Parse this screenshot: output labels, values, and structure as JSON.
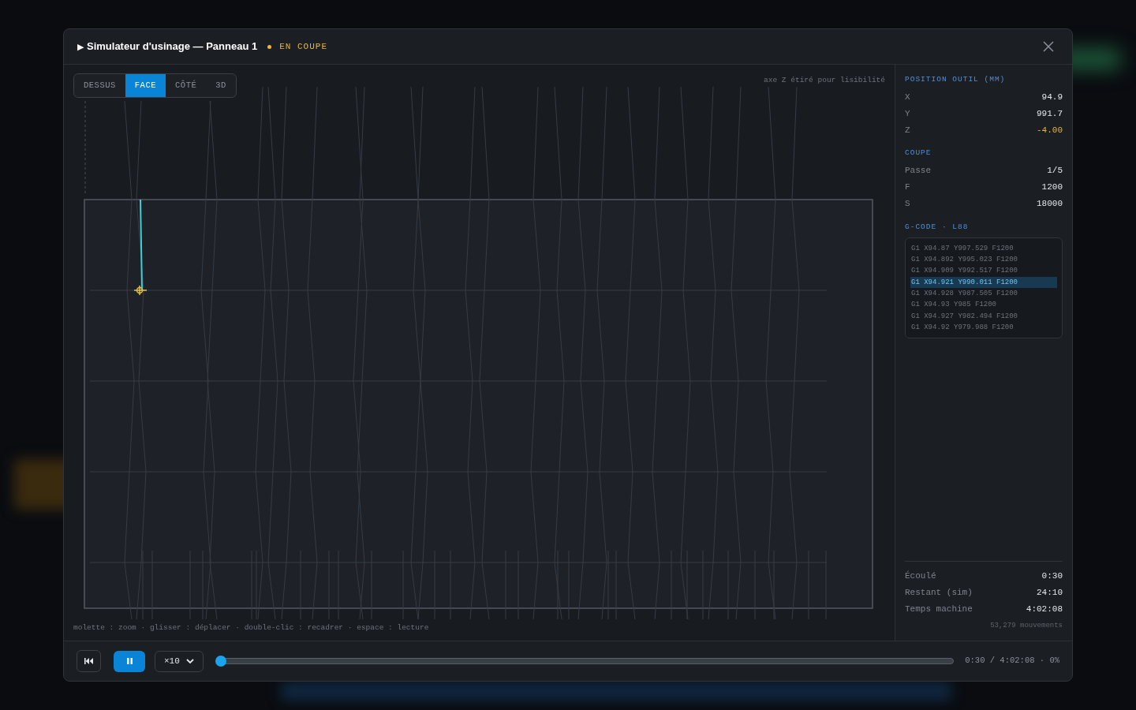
{
  "dialog": {
    "title_icon": "▶",
    "title": "Simulateur d'usinage — Panneau 1",
    "status": {
      "label": "EN COUPE",
      "active": true
    }
  },
  "view_tabs": [
    {
      "label": "DESSUS",
      "selected": false
    },
    {
      "label": "FACE",
      "selected": true
    },
    {
      "label": "CÔTÉ",
      "selected": false
    },
    {
      "label": "3D",
      "selected": false
    }
  ],
  "canvas": {
    "note": "axe Z étiré pour lisibilité",
    "hint": "molette : zoom · glisser : déplacer · double-clic : recadrer · espace : lecture"
  },
  "tool_position": {
    "title": "POSITION OUTIL (MM)",
    "rows": [
      {
        "label": "X",
        "value": "94.9",
        "highlight": false
      },
      {
        "label": "Y",
        "value": "991.7",
        "highlight": false
      },
      {
        "label": "Z",
        "value": "-4.00",
        "highlight": true
      }
    ]
  },
  "cut": {
    "title": "COUPE",
    "rows": [
      {
        "label": "Passe",
        "value": "1/5"
      },
      {
        "label": "F",
        "value": "1200"
      },
      {
        "label": "S",
        "value": "18000"
      }
    ]
  },
  "gcode": {
    "title": "G-CODE · L88",
    "lines": [
      {
        "text": "G1 X94.87 Y997.529 F1200",
        "selected": false
      },
      {
        "text": "G1 X94.892 Y995.023 F1200",
        "selected": false
      },
      {
        "text": "G1 X94.909 Y992.517 F1200",
        "selected": false
      },
      {
        "text": "G1 X94.921 Y990.011 F1200",
        "selected": true
      },
      {
        "text": "G1 X94.928 Y987.505 F1200",
        "selected": false
      },
      {
        "text": "G1 X94.93 Y985 F1200",
        "selected": false
      },
      {
        "text": "G1 X94.927 Y982.494 F1200",
        "selected": false
      },
      {
        "text": "G1 X94.92 Y979.988 F1200",
        "selected": false
      }
    ]
  },
  "times": [
    {
      "label": "Écoulé",
      "value": "0:30"
    },
    {
      "label": "Restant (sim)",
      "value": "24:10"
    },
    {
      "label": "Temps machine",
      "value": "4:02:08"
    }
  ],
  "moves": "53,279 mouvements",
  "player": {
    "playing": true,
    "speed": "×10",
    "level": 0.0,
    "readout": "0:30 / 4:02:08 · 0%"
  }
}
